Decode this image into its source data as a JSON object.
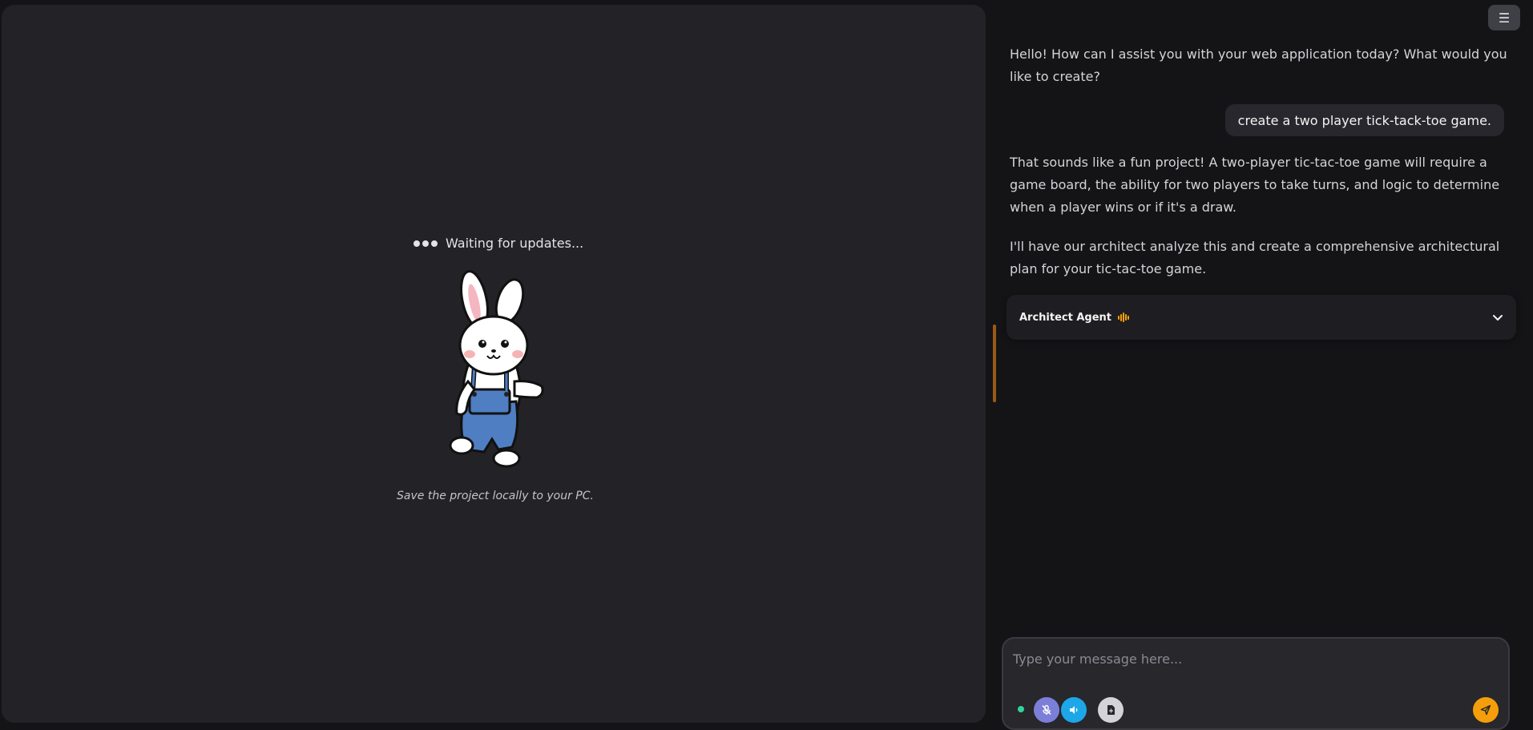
{
  "preview": {
    "status": "Waiting for updates...",
    "save_note": "Save the project locally to your PC."
  },
  "header": {
    "menu_icon": "☰"
  },
  "chat": {
    "messages": [
      {
        "role": "assistant",
        "text": "Hello! How can I assist you with your web application today? What would you like to create?"
      },
      {
        "role": "user",
        "text": "create a two player tick-tack-toe game."
      },
      {
        "role": "assistant",
        "text": "That sounds like a fun project! A two-player tic-tac-toe game will require a game board, the ability for two players to take turns, and logic to determine when a player wins or if it's a draw."
      },
      {
        "role": "assistant",
        "text": "I'll have our architect analyze this and create a comprehensive architectural plan for your tic-tac-toe game."
      }
    ],
    "agent_card": {
      "name": "Architect Agent"
    }
  },
  "composer": {
    "placeholder": "Type your message here..."
  },
  "colors": {
    "accent": "#f59e0b",
    "mic": "#7c7fd8",
    "speaker": "#1ea7e8",
    "status_online": "#34d399"
  }
}
